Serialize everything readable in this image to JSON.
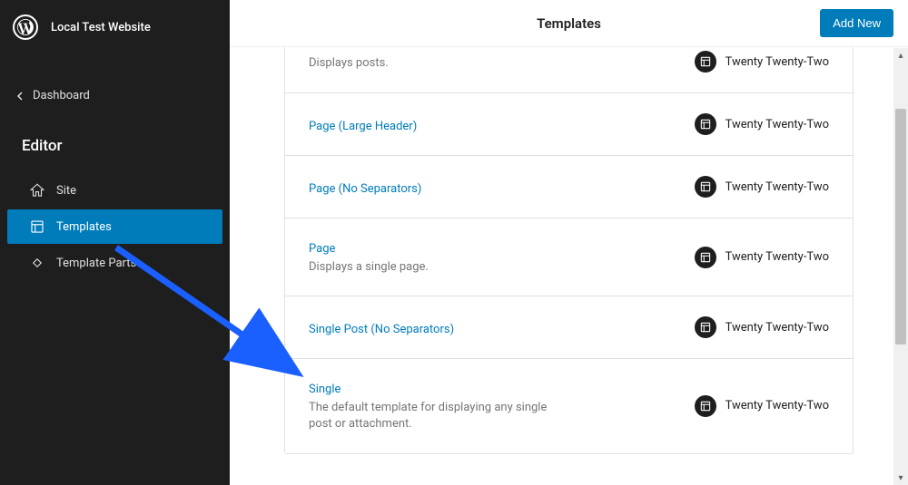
{
  "site_name": "Local Test Website",
  "back_link_label": "Dashboard",
  "editor_title": "Editor",
  "nav": {
    "site": "Site",
    "templates": "Templates",
    "template_parts": "Template Parts"
  },
  "page_title": "Templates",
  "add_new_label": "Add New",
  "theme_name": "Twenty Twenty-Two",
  "templates": [
    {
      "name_partial": "",
      "desc": "Displays posts."
    },
    {
      "name": "Page (Large Header)",
      "desc": ""
    },
    {
      "name": "Page (No Separators)",
      "desc": ""
    },
    {
      "name": "Page",
      "desc": "Displays a single page."
    },
    {
      "name": "Single Post (No Separators)",
      "desc": ""
    },
    {
      "name": "Single",
      "desc": "The default template for displaying any single post or attachment."
    }
  ]
}
